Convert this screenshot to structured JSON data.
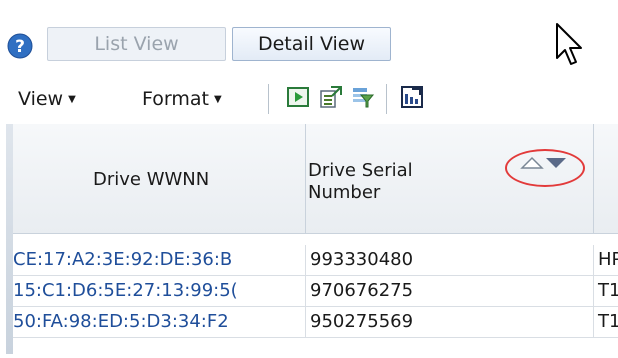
{
  "toggle": {
    "list_view_label": "List View",
    "detail_view_label": "Detail View"
  },
  "toolbar": {
    "view_label": "View",
    "format_label": "Format",
    "tools": [
      {
        "name": "run-icon"
      },
      {
        "name": "export-icon"
      },
      {
        "name": "filter-icon"
      },
      {
        "name": "detach-icon"
      }
    ]
  },
  "table": {
    "columns": [
      "Drive WWNN",
      "Drive Serial\nNumber",
      ""
    ],
    "sort_indicator": "descending",
    "rows": [
      {
        "wwnn": "CE:17:A2:3E:92:DE:36:B",
        "serial": "993330480",
        "col3": "HP"
      },
      {
        "wwnn": "15:C1:D6:5E:27:13:99:5(",
        "serial": "970676275",
        "col3": "T1"
      },
      {
        "wwnn": "50:FA:98:ED:5:D3:34:F2",
        "serial": "950275569",
        "col3": "T1"
      }
    ]
  },
  "colors": {
    "link": "#1f4e9a",
    "highlight_ellipse": "#e23a3a",
    "help_icon": "#2f6fc2"
  }
}
